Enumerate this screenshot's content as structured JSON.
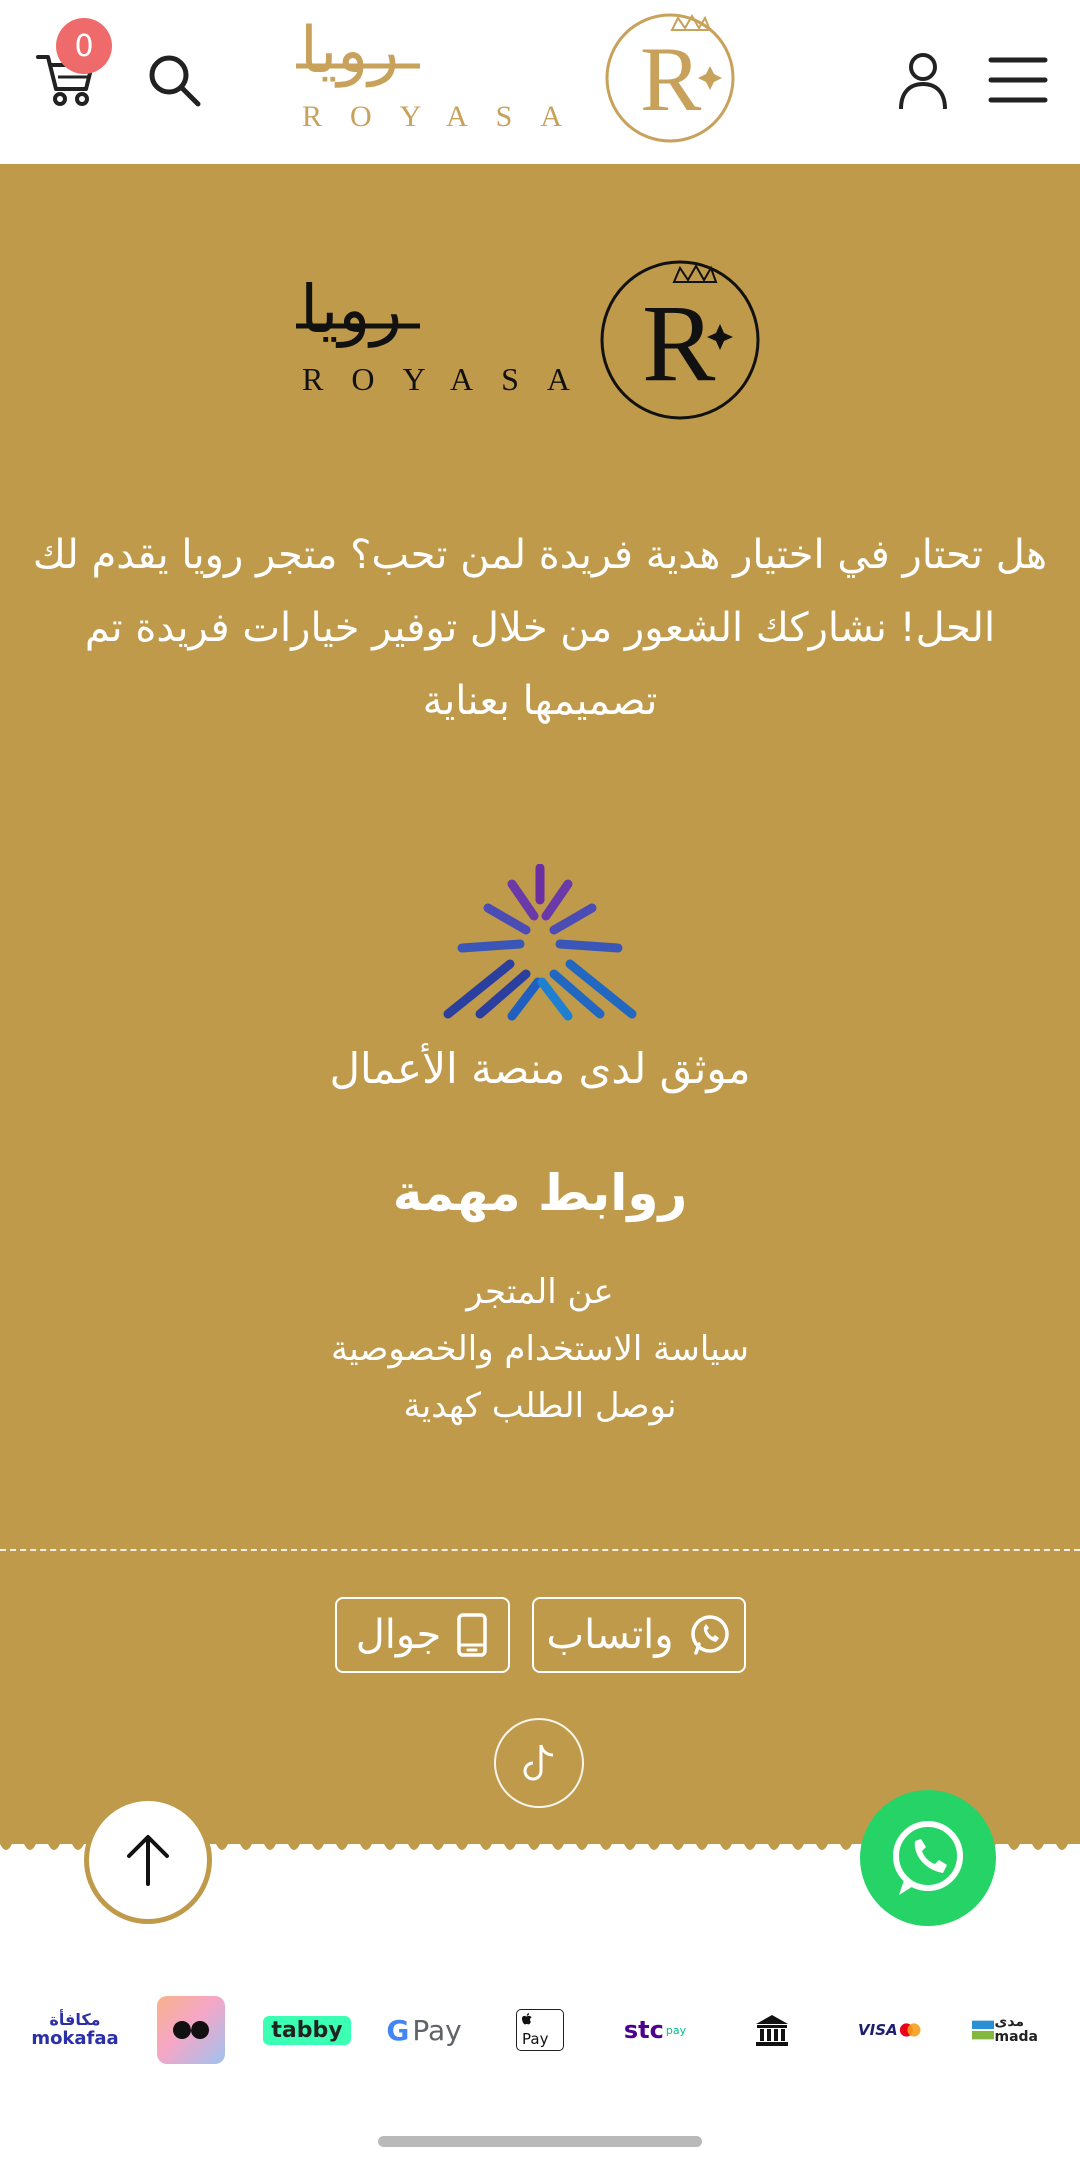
{
  "header": {
    "cart_count": "0",
    "brand_ar": "رويا",
    "brand_en": "ROYASA",
    "brand_letter": "R"
  },
  "footer": {
    "brand_ar": "رويا",
    "brand_en": "ROYASA",
    "brand_letter": "R",
    "about_text": "هل تحتار في اختيار هدية فريدة لمن تحب؟ متجر رويا يقدم لك الحل! نشاركك الشعور من خلال توفير خيارات فريدة تم تصميمها بعناية",
    "verified_text": "موثق لدى منصة الأعمال",
    "links_title": "روابط مهمة",
    "links": [
      {
        "label": "عن المتجر"
      },
      {
        "label": "سياسة الاستخدام والخصوصية"
      },
      {
        "label": "نوصل الطلب كهدية"
      }
    ],
    "contact": {
      "whatsapp_label": "واتساب",
      "mobile_label": "جوال"
    }
  },
  "payments": {
    "mokafaa_ar": "مكافأة",
    "mokafaa_en": "mokafaa",
    "tabby": "tabby",
    "gpay_g": "G",
    "gpay_pay": "Pay",
    "apple_pay": "Pay",
    "stc": "stc",
    "stc_pay": "pay",
    "visa": "VISA",
    "mada_ar": "مدى",
    "mada_en": "mada"
  },
  "colors": {
    "brand_gold": "#bf9a4b",
    "badge_red": "#ef6b6b",
    "whatsapp_green": "#25d366"
  },
  "icons": [
    "cart-icon",
    "search-icon",
    "user-icon",
    "menu-icon",
    "whatsapp-icon",
    "mobile-icon",
    "tiktok-icon",
    "arrow-up-icon",
    "bank-icon",
    "mastercard-icon"
  ]
}
